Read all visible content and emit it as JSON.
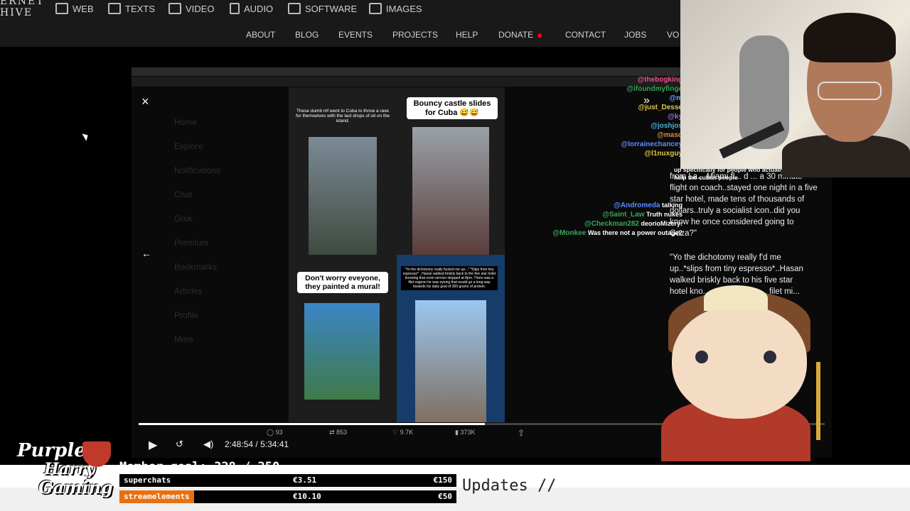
{
  "site": {
    "logo_line1": "ERNET",
    "logo_line2": "HIVE",
    "categories": [
      "WEB",
      "TEXTS",
      "VIDEO",
      "AUDIO",
      "SOFTWARE",
      "IMAGES"
    ],
    "nav": [
      "ABOUT",
      "BLOG",
      "EVENTS",
      "PROJECTS",
      "HELP",
      "DONATE",
      "CONTACT",
      "JOBS",
      "VO"
    ]
  },
  "video": {
    "current_time": "2:48:54",
    "total_time": "5:34:41",
    "progress": 0.5045,
    "close_glyph": "×",
    "back_glyph": "←",
    "next_glyph": "»",
    "stats": {
      "replies": "93",
      "reposts": "853",
      "likes": "9.7K",
      "views": "373K"
    },
    "panels": [
      {
        "caption": "These dumb mf went to Cuba to throw a rave for themselves with the last drops of oil on the island."
      },
      {
        "caption": "Bouncy castle slides for Cuba 😅😅"
      },
      {
        "caption": "Don't worry eveyone, they painted a mural!"
      },
      {
        "caption": "\"Yo the dichotomy really fucked me up...\" *Slips from tiny espresso* ..Hasan walked briskly back to the five star hotel knowing that room service stopped at 8pm. There was a filet mignon he was eyeing that would go a long way towards his daily goal of 300 grams of protein."
      }
    ],
    "side_menu": [
      "Home",
      "Explore",
      "Notifications",
      "Chat",
      "Grok",
      "Premium",
      "Bookmarks",
      "Articles",
      "Profile",
      "More"
    ]
  },
  "chat": {
    "lines": [
      {
        "user": "@thebogking",
        "text": "",
        "color": "#e94b8a"
      },
      {
        "user": "@ifoundmyfinge",
        "text": "",
        "color": "#3aa757"
      },
      {
        "user": "@m",
        "text": "",
        "color": "#6aa0ff"
      },
      {
        "user": "@just_Desse",
        "text": "",
        "color": "#d9c84a"
      },
      {
        "user": "@ky",
        "text": "",
        "color": "#9b6bd9"
      },
      {
        "user": "@joshjos",
        "text": "",
        "color": "#4fb0d6"
      },
      {
        "user": "@masq",
        "text": "",
        "color": "#d98a3a"
      },
      {
        "user": "@lorrainechancey",
        "text": "",
        "color": "#5b8cff"
      },
      {
        "user": "@l1nuxguy",
        "text": "",
        "color": "#d9c84a"
      },
      {
        "user": "@Andromeda",
        "text": "talking",
        "color": "#5b8cff"
      },
      {
        "user": "@Saint_Law",
        "text": "Truth nukes",
        "color": "#3aa757"
      },
      {
        "user": "@Checkman282",
        "text": "deorioMizcry:",
        "color": "#3aa757"
      },
      {
        "user": "@Monkee",
        "text": "Was there not a power outage?",
        "color": "#3aa757"
      }
    ],
    "pinned": "up specifically for people who actually want to help the cuban people"
  },
  "tweet_text_1": "from La... Miami fl... d ... a 30 minute flight on coach..stayed one night in a five star hotel, made tens of thousands of dollars..truly a socialist icon..did you know he once considered going to Gaza?\"",
  "tweet_text_2": "\"Yo the dichotomy really f'd me up..*slips from tiny espresso*..Hasan walked briskly back to his five star hotel kno... service stopp... filet mi...",
  "overlay": {
    "logo_line1": "Purple",
    "logo_line2": "Harry",
    "logo_line3": "Gaming",
    "member_goal_label": "Member goal:",
    "member_goal_current": "328",
    "member_goal_target": "250",
    "rows": [
      {
        "label": "superchats",
        "amount": "€3.51",
        "goal": "€150",
        "color": "#111111"
      },
      {
        "label": "streamelements",
        "amount": "€10.10",
        "goal": "€50",
        "color": "#e8700e"
      }
    ],
    "ticker": "Updates //"
  }
}
